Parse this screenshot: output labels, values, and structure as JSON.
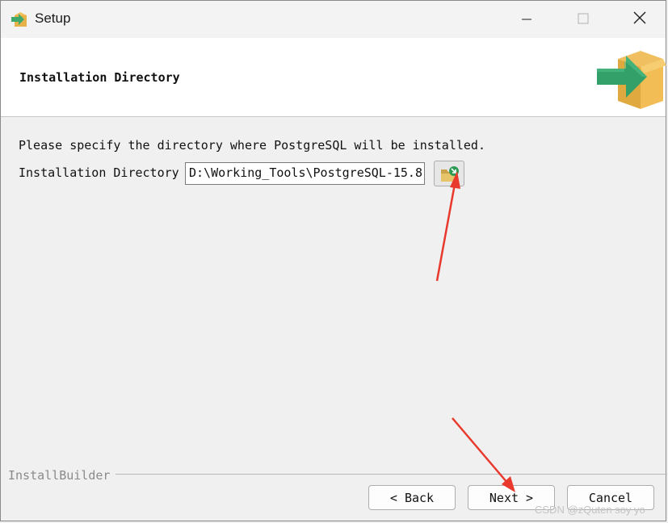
{
  "window": {
    "title": "Setup",
    "app_icon": "installer-box-arrow-icon",
    "controls": [
      "minimize-icon",
      "maximize-icon",
      "close-icon"
    ]
  },
  "header": {
    "title": "Installation Directory",
    "logo": "installer-box-arrow-icon"
  },
  "main": {
    "description": "Please specify the directory where PostgreSQL will be installed.",
    "directory_label": "Installation Directory",
    "directory_value": "D:\\Working_Tools\\PostgreSQL-15.8",
    "browse_icon": "folder-browse-icon"
  },
  "footer": {
    "builder_label": "InstallBuilder",
    "back_label": "< Back",
    "next_label": "Next >",
    "cancel_label": "Cancel"
  },
  "watermark": "CSDN @zQuten soy yo",
  "annotation_color": "#e8392c"
}
